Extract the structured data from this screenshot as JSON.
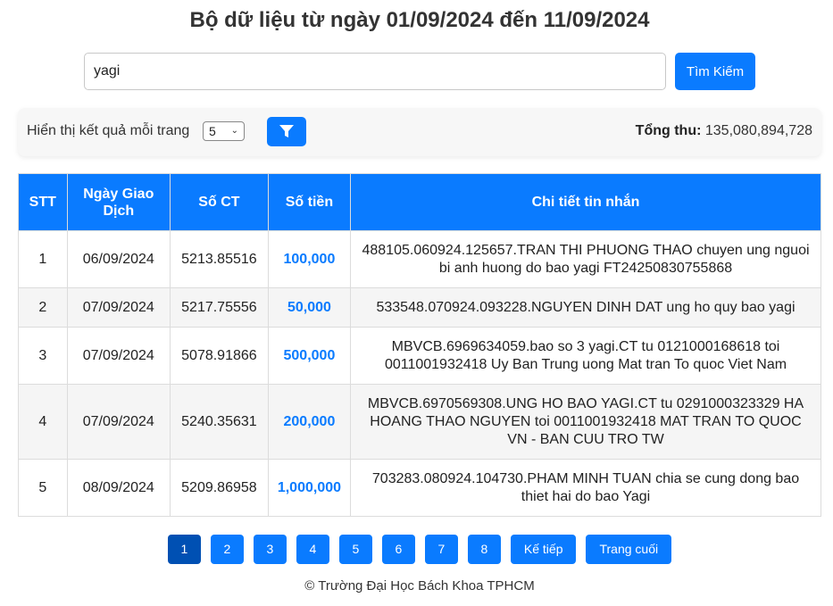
{
  "page": {
    "title": "Bộ dữ liệu từ ngày 01/09/2024 đến 11/09/2024"
  },
  "search": {
    "value": "yagi",
    "button_label": "Tìm Kiếm"
  },
  "filter": {
    "label": "Hiển thị kết quả mỗi trang",
    "page_size": "5",
    "total_label": "Tổng thu:",
    "total_value": "135,080,894,728"
  },
  "table": {
    "headers": [
      "STT",
      "Ngày Giao Dịch",
      "Số CT",
      "Số tiền",
      "Chi tiết tin nhắn"
    ],
    "rows": [
      {
        "stt": "1",
        "date": "06/09/2024",
        "ct": "5213.85516",
        "amount": "100,000",
        "detail": "488105.060924.125657.TRAN THI PHUONG THAO chuyen ung nguoi bi anh huong do bao yagi FT24250830755868"
      },
      {
        "stt": "2",
        "date": "07/09/2024",
        "ct": "5217.75556",
        "amount": "50,000",
        "detail": "533548.070924.093228.NGUYEN DINH DAT ung ho quy bao yagi"
      },
      {
        "stt": "3",
        "date": "07/09/2024",
        "ct": "5078.91866",
        "amount": "500,000",
        "detail": "MBVCB.6969634059.bao so 3 yagi.CT tu 0121000168618 toi 0011001932418 Uy Ban Trung uong Mat tran To quoc Viet Nam"
      },
      {
        "stt": "4",
        "date": "07/09/2024",
        "ct": "5240.35631",
        "amount": "200,000",
        "detail": "MBVCB.6970569308.UNG HO BAO YAGI.CT tu 0291000323329 HA HOANG THAO NGUYEN toi 0011001932418 MAT TRAN TO QUOC VN - BAN CUU TRO TW"
      },
      {
        "stt": "5",
        "date": "08/09/2024",
        "ct": "5209.86958",
        "amount": "1,000,000",
        "detail": "703283.080924.104730.PHAM MINH TUAN chia se cung dong bao thiet hai do bao Yagi"
      }
    ]
  },
  "pagination": {
    "pages": [
      "1",
      "2",
      "3",
      "4",
      "5",
      "6",
      "7",
      "8"
    ],
    "current": "1",
    "next_label": "Kế tiếp",
    "last_label": "Trang cuối"
  },
  "footer": {
    "text": "© Trường Đại Học Bách Khoa TPHCM"
  },
  "colors": {
    "accent": "#0a7bff",
    "active_page": "#0050b3"
  }
}
